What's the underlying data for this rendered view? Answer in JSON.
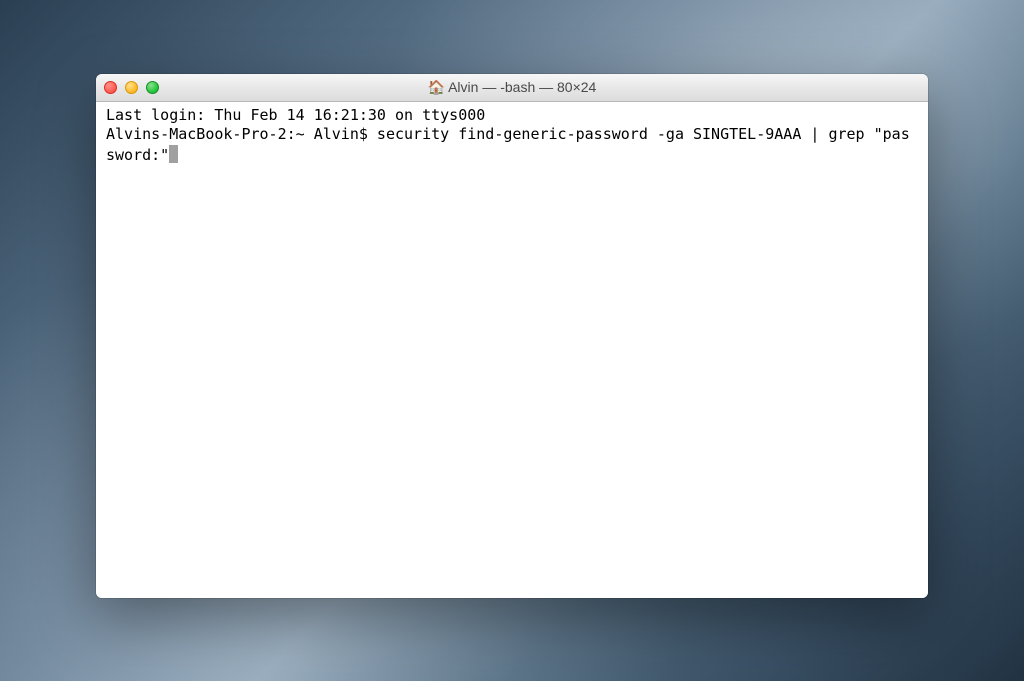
{
  "window": {
    "title_text": "Alvin — -bash — 80×24",
    "icon": "home-icon"
  },
  "terminal": {
    "lines": [
      "Last login: Thu Feb 14 16:21:30 on ttys000",
      "Alvins-MacBook-Pro-2:~ Alvin$ security find-generic-password -ga SINGTEL-9AAA | grep \"password:\""
    ]
  }
}
